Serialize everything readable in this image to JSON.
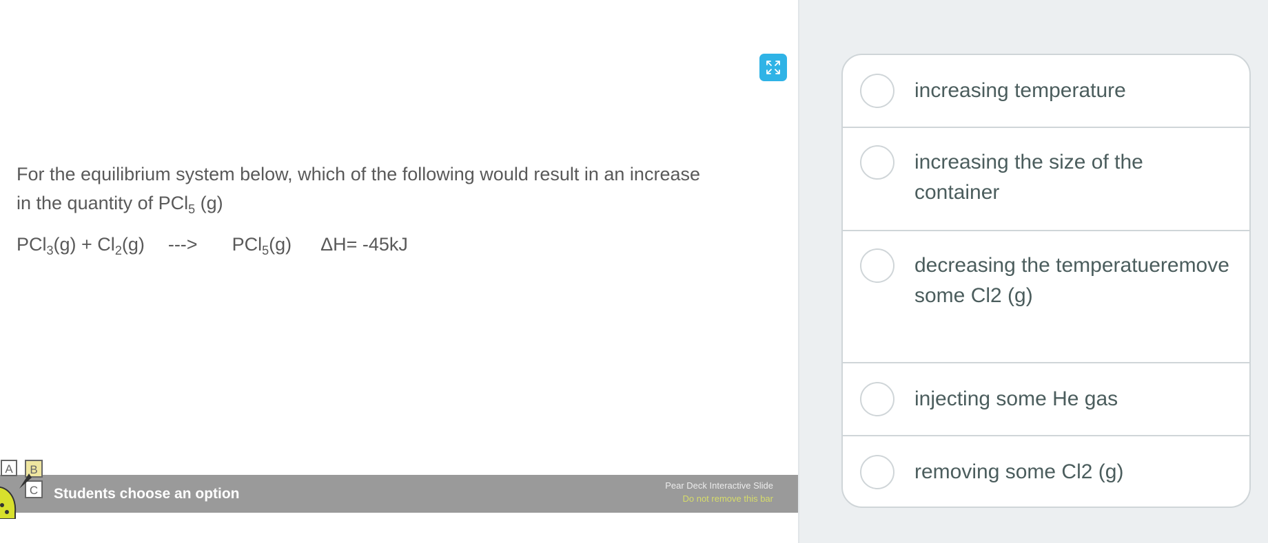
{
  "question": {
    "text_before_sub": "For the equilibrium system below, which of the following would result in an increase in the quantity of PCl",
    "sub": "5",
    "text_after_sub": " (g)"
  },
  "equation": {
    "reactant1": "PCl",
    "reactant1_sub": "3",
    "reactant1_state": "(g) + Cl",
    "reactant2_sub": "2",
    "reactant2_state": "(g)",
    "arrow": "--->",
    "product": "PCl",
    "product_sub": "5",
    "product_state": "(g)",
    "enthalpy": "ΔH= -45kJ"
  },
  "pear_deck_bar": {
    "label": "Students choose an option",
    "brand": "Pear Deck Interactive Slide",
    "warning": "Do not remove this bar",
    "logo_letters": [
      "A",
      "B",
      "C"
    ]
  },
  "options": [
    {
      "label": "increasing temperature"
    },
    {
      "label": "increasing the size of the container"
    },
    {
      "label": "decreasing the temperatueremove some Cl2 (g)"
    },
    {
      "label": "injecting some He gas"
    },
    {
      "label": "removing some Cl2 (g)"
    }
  ],
  "icons": {
    "expand": "expand-icon",
    "logo": "pear-deck-logo-icon"
  },
  "colors": {
    "expand_button": "#2fb3e6",
    "bar": "#9a9a9a",
    "bar_warning": "#d6dc6a",
    "option_text": "#4b5d5d",
    "panel_bg": "#eceff1"
  }
}
